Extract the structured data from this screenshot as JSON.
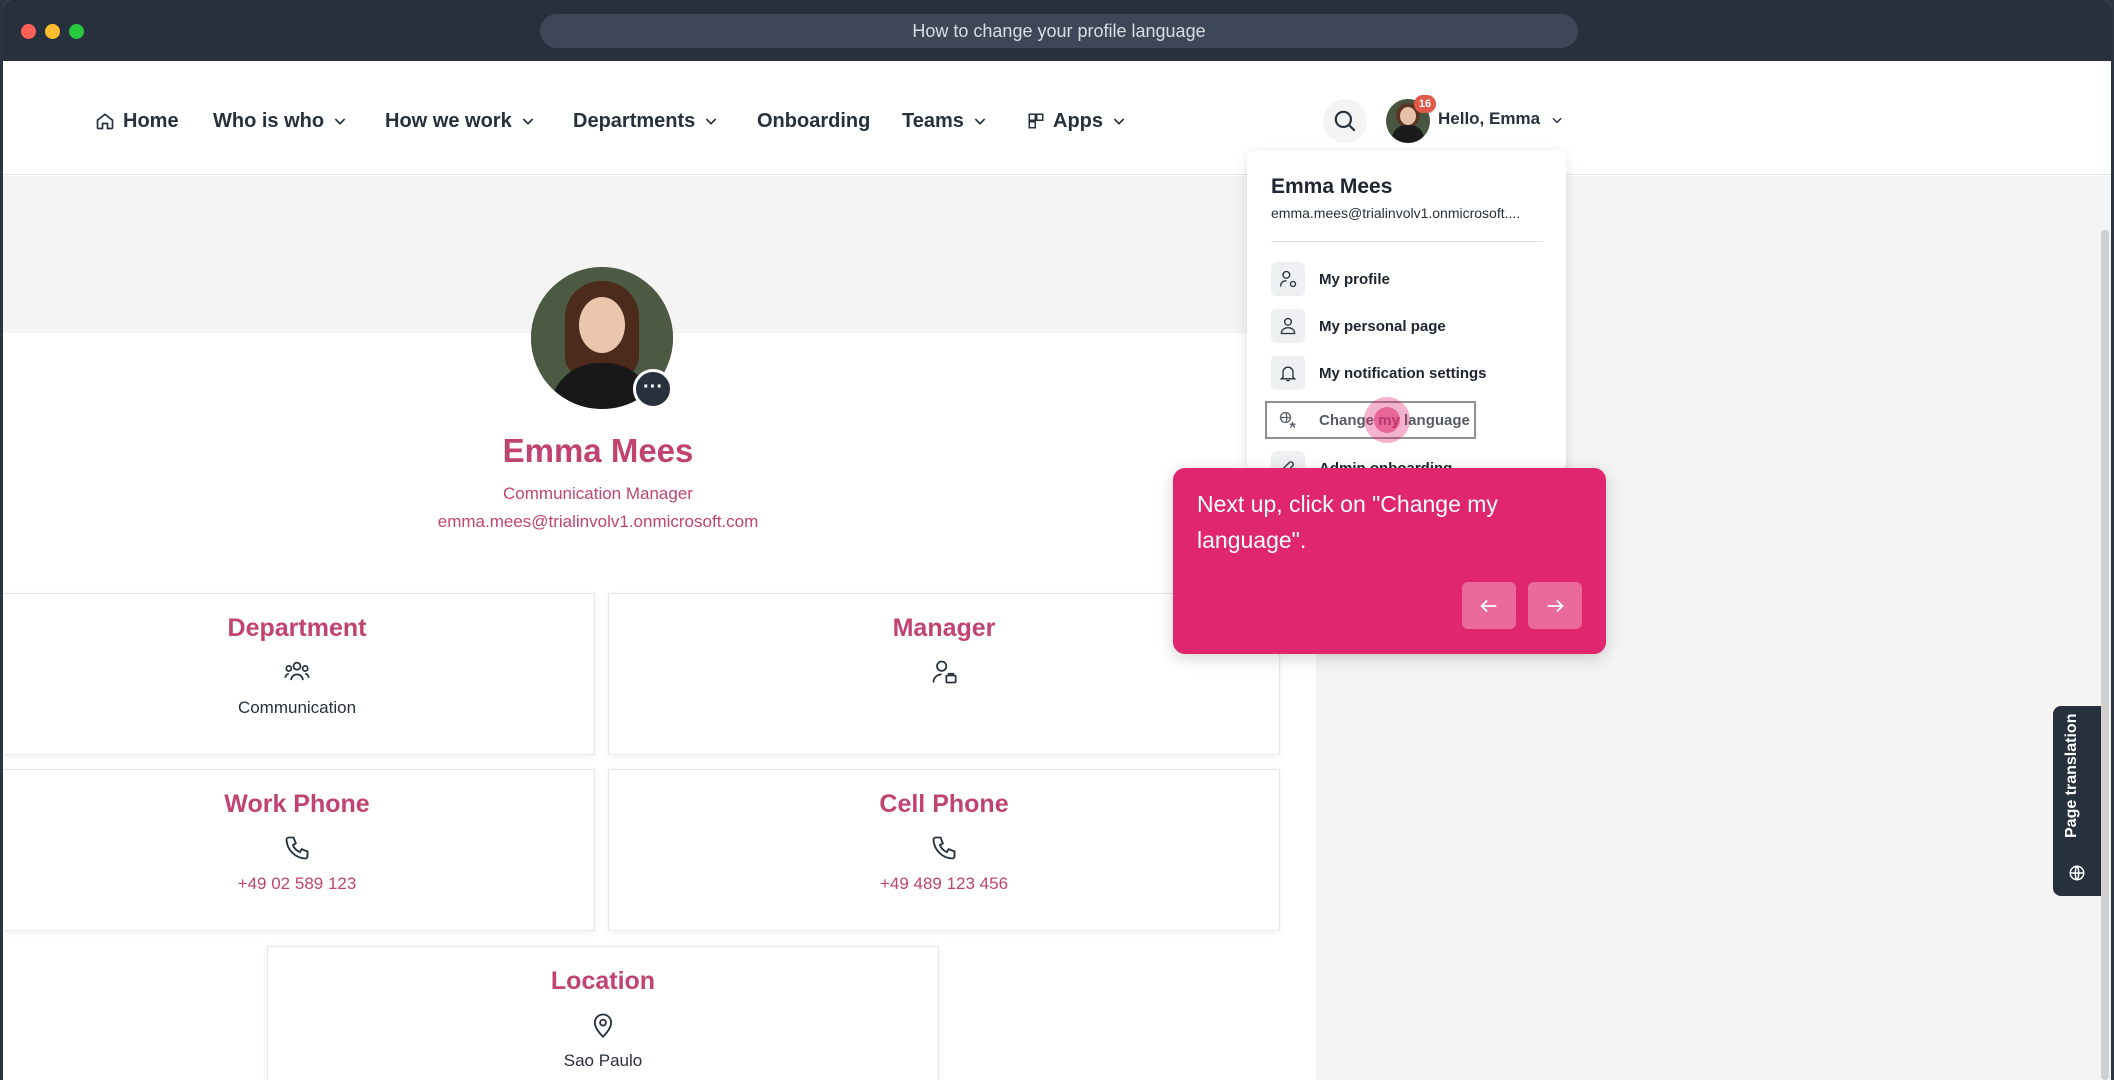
{
  "browser": {
    "url_title": "How to change your profile language",
    "dot_colors": [
      "#ff5f57",
      "#febc2e",
      "#28c840"
    ]
  },
  "nav": {
    "home": "Home",
    "who_is_who": "Who is who",
    "how_we_work": "How we work",
    "departments": "Departments",
    "onboarding": "Onboarding",
    "teams": "Teams",
    "apps": "Apps",
    "notification_count": "16",
    "greeting": "Hello, Emma"
  },
  "profile": {
    "name": "Emma Mees",
    "role": "Communication Manager",
    "email": "emma.mees@trialinvolv1.onmicrosoft.com",
    "more_icon": "ellipsis-icon"
  },
  "cards": {
    "department": {
      "title": "Department",
      "value": "Communication",
      "icon": "team-icon"
    },
    "manager": {
      "title": "Manager",
      "value": "",
      "icon": "manager-icon"
    },
    "work_phone": {
      "title": "Work Phone",
      "value": "+49 02 589 123",
      "icon": "phone-icon"
    },
    "cell_phone": {
      "title": "Cell Phone",
      "value": "+49 489 123 456",
      "icon": "phone-icon"
    },
    "location": {
      "title": "Location",
      "value": "Sao Paulo",
      "icon": "location-icon"
    }
  },
  "dropdown": {
    "name": "Emma Mees",
    "email": "emma.mees@trialinvolv1.onmicrosoft....",
    "items": [
      {
        "label": "My profile",
        "icon": "profile-gear-icon"
      },
      {
        "label": "My personal page",
        "icon": "person-icon"
      },
      {
        "label": "My notification settings",
        "icon": "bell-icon"
      },
      {
        "label": "Change my language",
        "icon": "language-icon"
      },
      {
        "label": "Admin onboarding",
        "icon": "rocket-icon"
      }
    ]
  },
  "tooltip": {
    "text": "Next up, click on \"Change my language\"."
  },
  "page_translation": {
    "label": "Page translation"
  },
  "colors": {
    "accent": "#c0446f",
    "tooltip": "#e0266e",
    "dark": "#27303d"
  }
}
